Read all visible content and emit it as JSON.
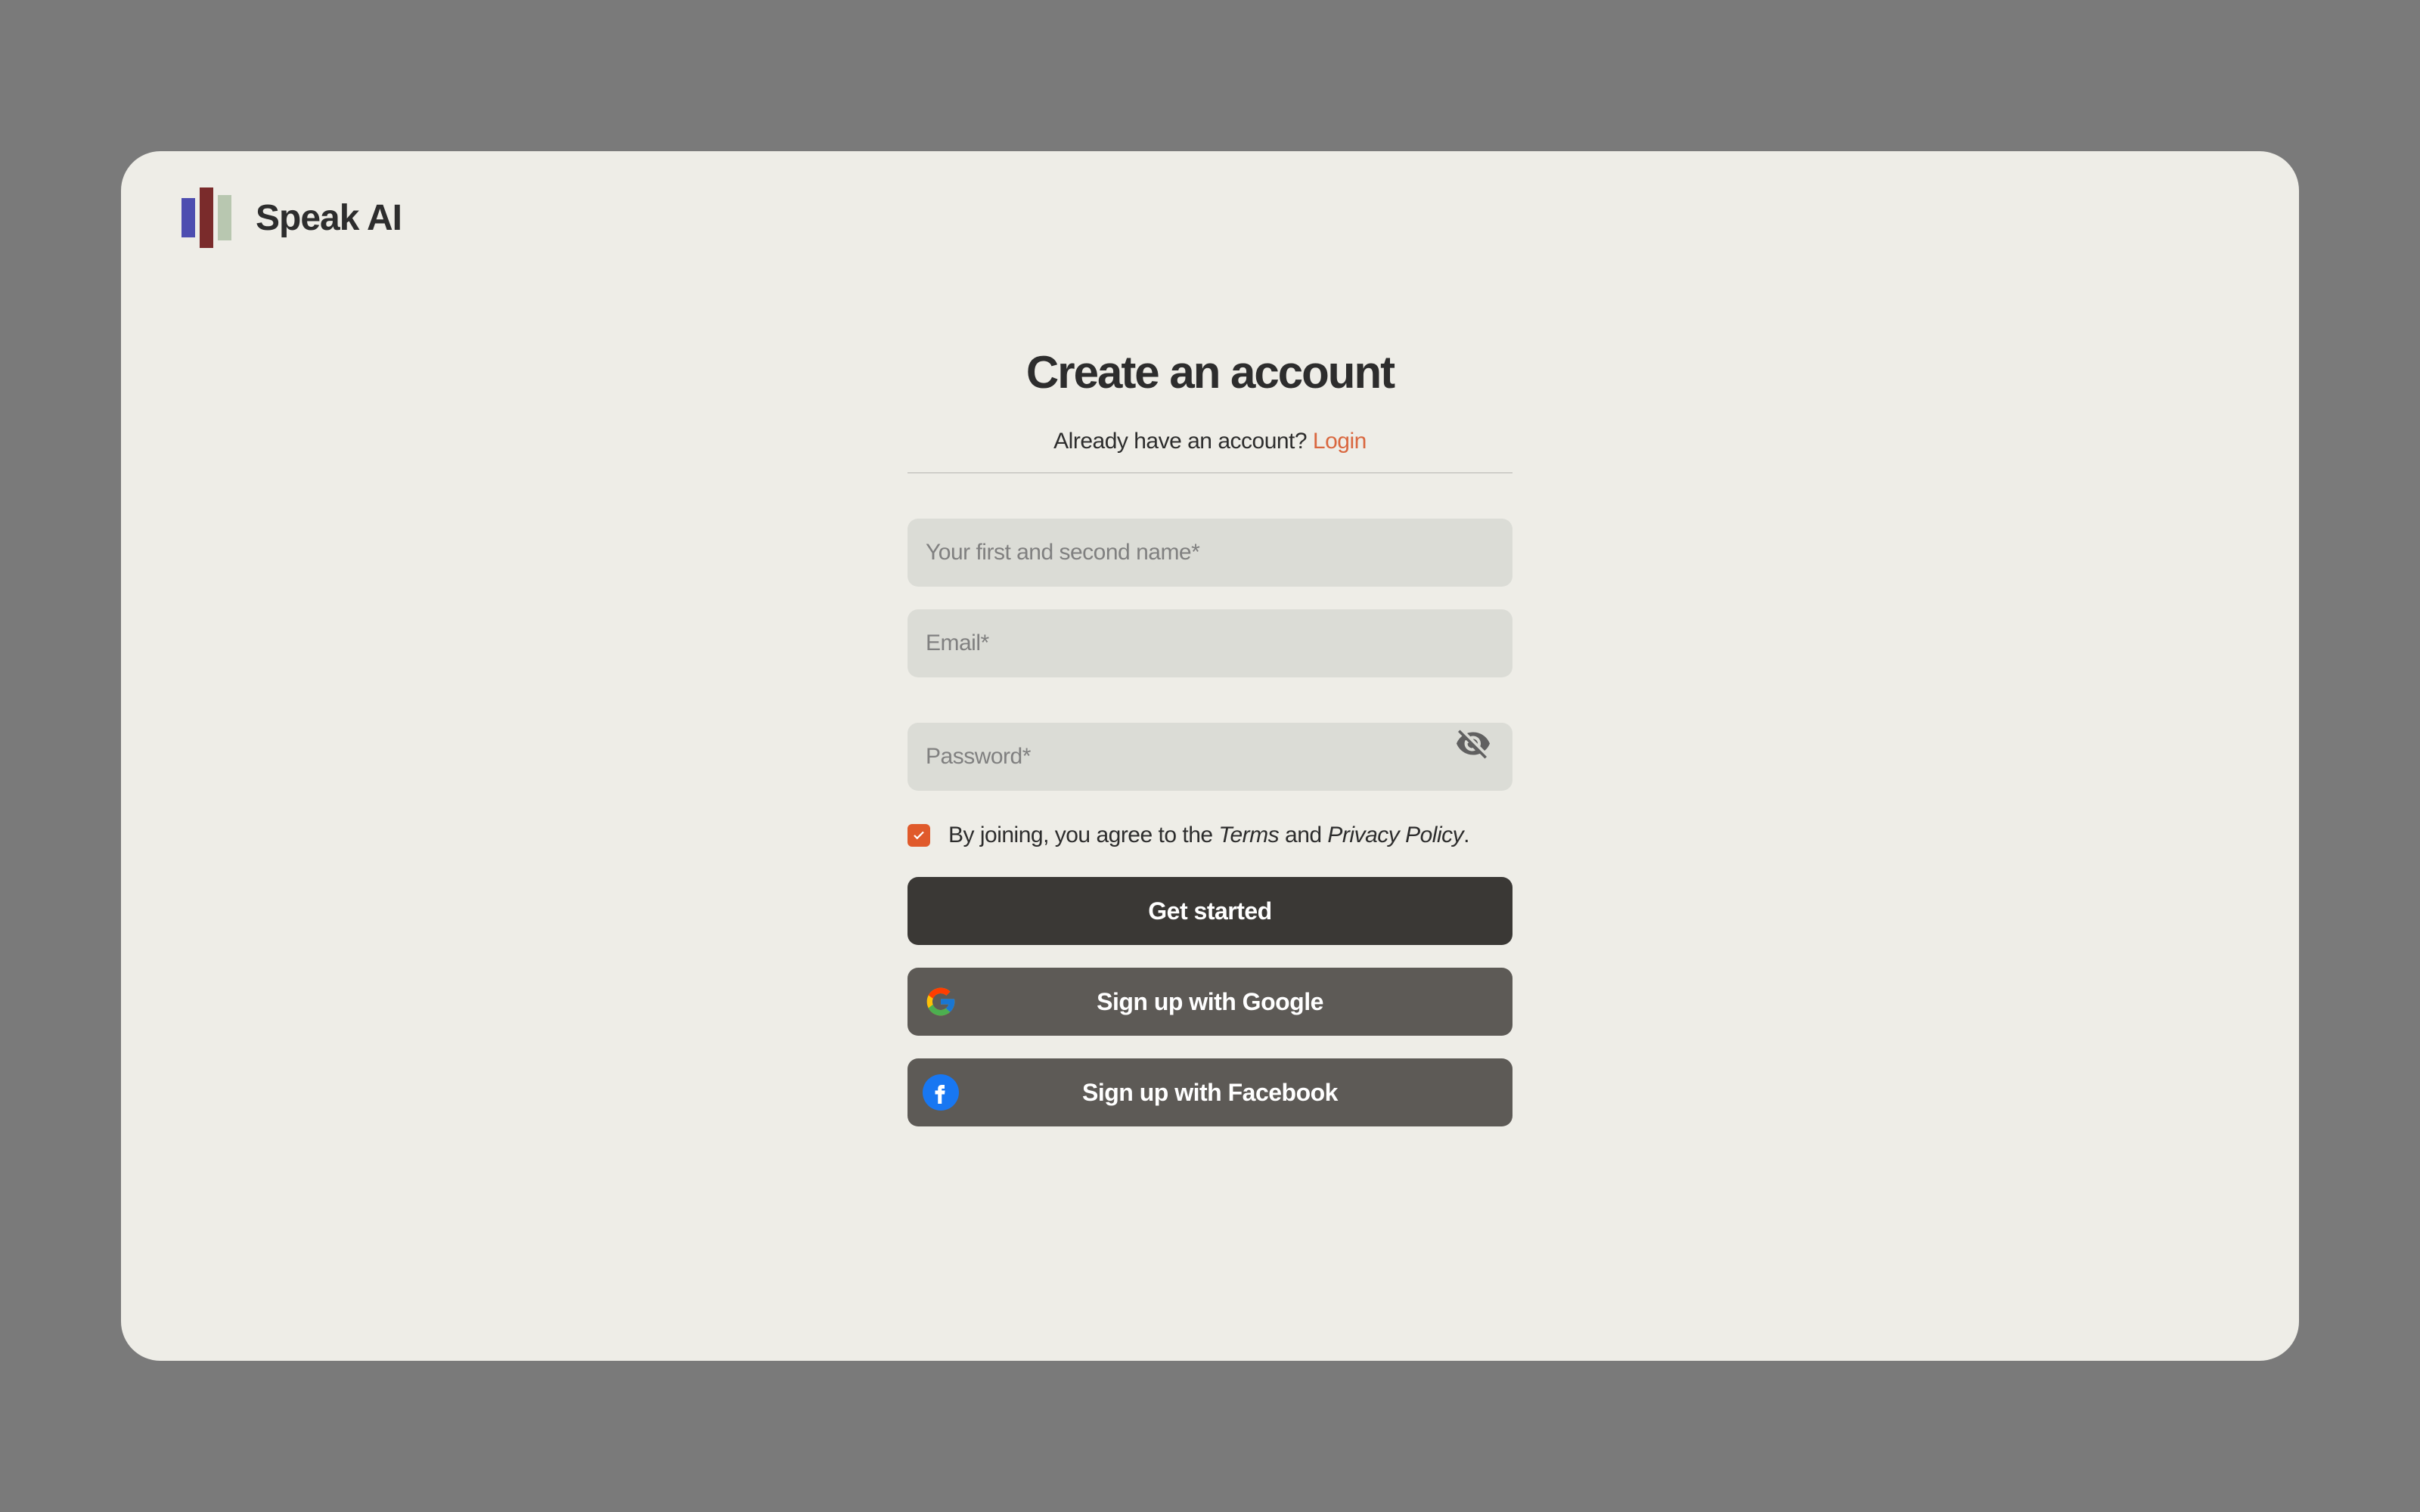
{
  "header": {
    "logo_text": "Speak AI"
  },
  "form": {
    "title": "Create an account",
    "subtitle_prefix": "Already have an account? ",
    "login_link_text": "Login",
    "name_placeholder": "Your first and second name*",
    "email_placeholder": "Email*",
    "password_placeholder": "Password*",
    "terms_prefix": "By joining, you agree to the ",
    "terms_link": "Terms",
    "terms_and": " and ",
    "privacy_link": "Privacy Policy",
    "terms_suffix": ".",
    "checkbox_checked": true,
    "buttons": {
      "get_started": "Get started",
      "google": "Sign up with Google",
      "facebook": "Sign up with Facebook"
    }
  }
}
